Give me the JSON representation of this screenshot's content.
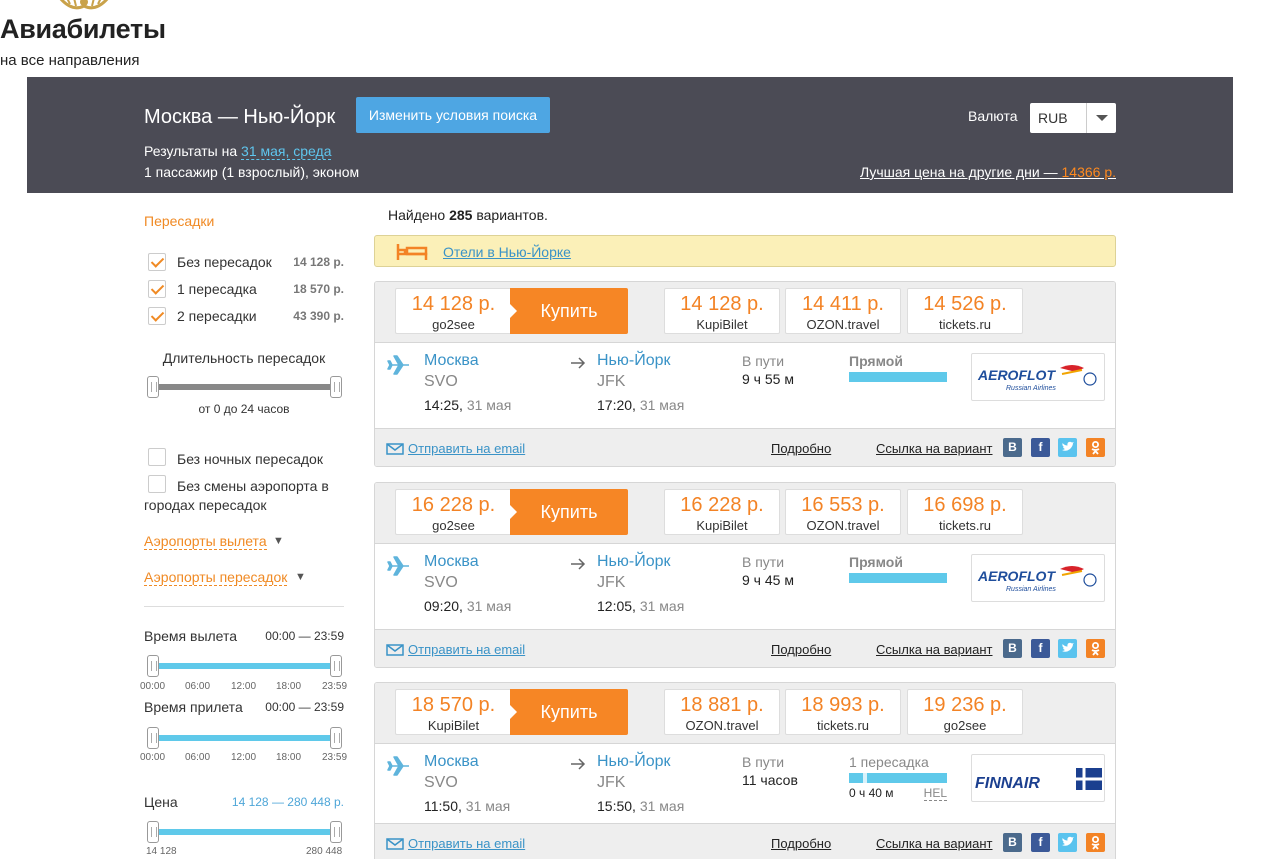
{
  "logo": {
    "title": "Авиабилеты",
    "subtitle": "на все направления"
  },
  "header": {
    "route": "Москва — Нью-Йорк",
    "change_button": "Изменить условия поиска",
    "results_prefix": "Результаты на",
    "results_date": "31 мая, среда",
    "passengers": "1 пассажир (1 взрослый), эконом",
    "currency_label": "Валюта",
    "currency_value": "RUB",
    "best_price_text": "Лучшая цена на другие дни —",
    "best_price_value": "14366 р."
  },
  "sidebar": {
    "stops_title": "Пересадки",
    "stops": [
      {
        "label": "Без пересадок",
        "price": "14 128 р.",
        "checked": true
      },
      {
        "label": "1 пересадка",
        "price": "18 570 р.",
        "checked": true
      },
      {
        "label": "2 пересадки",
        "price": "43 390 р.",
        "checked": true
      }
    ],
    "duration_title": "Длительность пересадок",
    "duration_range": "от 0 до 24 часов",
    "no_night": "Без ночных пересадок",
    "no_airport_change_1": "Без смены аэропорта в",
    "no_airport_change_2": "городах пересадок",
    "departure_airports": "Аэропорты вылета",
    "transfer_airports": "Аэропорты пересадок",
    "departure_time_title": "Время вылета",
    "departure_time_range": "00:00 — 23:59",
    "arrival_time_title": "Время прилета",
    "arrival_time_range": "00:00 — 23:59",
    "time_ticks": [
      "00:00",
      "06:00",
      "12:00",
      "18:00",
      "23:59"
    ],
    "price_title": "Цена",
    "price_range": "14 128 — 280 448 р.",
    "price_min": "14 128",
    "price_max": "280 448"
  },
  "main": {
    "found_prefix": "Найдено",
    "found_count": "285",
    "found_suffix": "вариантов.",
    "hotels_link": "Отели в Нью-Йорке"
  },
  "buy_label": "Купить",
  "in_way_label": "В пути",
  "footer": {
    "email": "Отправить на email",
    "details": "Подробно",
    "share": "Ссылка на вариант"
  },
  "results": [
    {
      "main_price": "14 128 р.",
      "main_agent": "go2see",
      "alts": [
        {
          "price": "14 128 р.",
          "agent": "KupiBilet"
        },
        {
          "price": "14 411 р.",
          "agent": "OZON.travel"
        },
        {
          "price": "14 526 р.",
          "agent": "tickets.ru"
        }
      ],
      "from_city": "Москва",
      "from_code": "SVO",
      "from_time": "14:25,",
      "from_date": "31 мая",
      "to_city": "Нью-Йорк",
      "to_code": "JFK",
      "to_time": "17:20,",
      "to_date": "31 мая",
      "duration": "9 ч 55 м",
      "stops": "Прямой",
      "airline": "aeroflot"
    },
    {
      "main_price": "16 228 р.",
      "main_agent": "go2see",
      "alts": [
        {
          "price": "16 228 р.",
          "agent": "KupiBilet"
        },
        {
          "price": "16 553 р.",
          "agent": "OZON.travel"
        },
        {
          "price": "16 698 р.",
          "agent": "tickets.ru"
        }
      ],
      "from_city": "Москва",
      "from_code": "SVO",
      "from_time": "09:20,",
      "from_date": "31 мая",
      "to_city": "Нью-Йорк",
      "to_code": "JFK",
      "to_time": "12:05,",
      "to_date": "31 мая",
      "duration": "9 ч 45 м",
      "stops": "Прямой",
      "airline": "aeroflot"
    },
    {
      "main_price": "18 570 р.",
      "main_agent": "KupiBilet",
      "alts": [
        {
          "price": "18 881 р.",
          "agent": "OZON.travel"
        },
        {
          "price": "18 993 р.",
          "agent": "tickets.ru"
        },
        {
          "price": "19 236 р.",
          "agent": "go2see"
        }
      ],
      "from_city": "Москва",
      "from_code": "SVO",
      "from_time": "11:50,",
      "from_date": "31 мая",
      "to_city": "Нью-Йорк",
      "to_code": "JFK",
      "to_time": "15:50,",
      "to_date": "31 мая",
      "duration": "11 часов",
      "stops": "1 пересадка",
      "layover_time": "0 ч 40 м",
      "layover_airport": "HEL",
      "airline": "finnair"
    }
  ],
  "colors": {
    "header_bg": "#4b4b55",
    "accent_orange": "#f68625",
    "link_blue": "#3a93c7",
    "slider_blue": "#5fc9ea",
    "hotels_bg": "#fbf0b8"
  }
}
